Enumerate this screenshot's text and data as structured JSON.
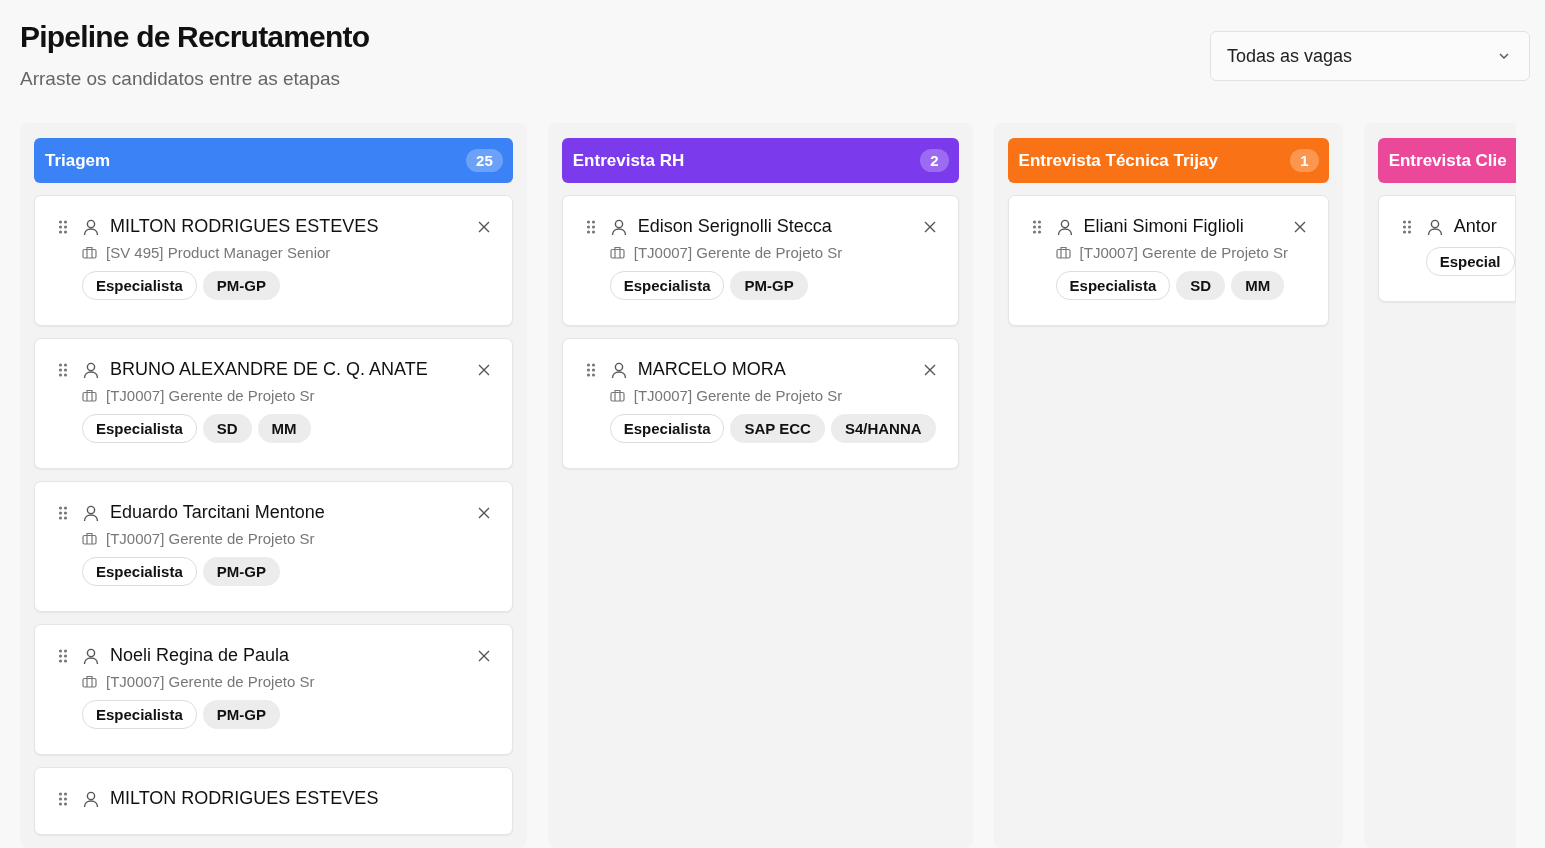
{
  "header": {
    "title": "Pipeline de Recrutamento",
    "subtitle": "Arraste os candidatos entre as etapas"
  },
  "filter": {
    "value": "Todas as vagas"
  },
  "columns": [
    {
      "title": "Triagem",
      "count": "25",
      "color": "#3b82f6",
      "cards": [
        {
          "name": "MILTON RODRIGUES ESTEVES",
          "job": "[SV 495] Product Manager Senior",
          "tags": [
            {
              "label": "Especialista",
              "kind": "level"
            },
            {
              "label": "PM-GP",
              "kind": "skill"
            }
          ]
        },
        {
          "name": "BRUNO ALEXANDRE DE C. Q. ANATE",
          "job": "[TJ0007] Gerente de Projeto Sr",
          "tags": [
            {
              "label": "Especialista",
              "kind": "level"
            },
            {
              "label": "SD",
              "kind": "skill"
            },
            {
              "label": "MM",
              "kind": "skill"
            }
          ]
        },
        {
          "name": "Eduardo Tarcitani Mentone",
          "job": "[TJ0007] Gerente de Projeto Sr",
          "tags": [
            {
              "label": "Especialista",
              "kind": "level"
            },
            {
              "label": "PM-GP",
              "kind": "skill"
            }
          ]
        },
        {
          "name": "Noeli Regina de Paula",
          "job": "[TJ0007] Gerente de Projeto Sr",
          "tags": [
            {
              "label": "Especialista",
              "kind": "level"
            },
            {
              "label": "PM-GP",
              "kind": "skill"
            }
          ]
        },
        {
          "name": "MILTON RODRIGUES ESTEVES"
        }
      ]
    },
    {
      "title": "Entrevista RH",
      "count": "2",
      "color": "#7c3aed",
      "cards": [
        {
          "name": "Edison Serignolli Stecca",
          "job": "[TJ0007] Gerente de Projeto Sr",
          "tags": [
            {
              "label": "Especialista",
              "kind": "level"
            },
            {
              "label": "PM-GP",
              "kind": "skill"
            }
          ]
        },
        {
          "name": "MARCELO MORA",
          "job": "[TJ0007] Gerente de Projeto Sr",
          "tags": [
            {
              "label": "Especialista",
              "kind": "level"
            },
            {
              "label": "SAP ECC",
              "kind": "skill"
            },
            {
              "label": "S4/HANNA",
              "kind": "skill"
            }
          ]
        }
      ]
    },
    {
      "title": "Entrevista Técnica Trijay",
      "count": "1",
      "color": "#f97316",
      "cards": [
        {
          "name": "Eliani Simoni Figlioli",
          "job": "[TJ0007] Gerente de Projeto Sr",
          "tags": [
            {
              "label": "Especialista",
              "kind": "level"
            },
            {
              "label": "SD",
              "kind": "skill"
            },
            {
              "label": "MM",
              "kind": "skill"
            }
          ]
        }
      ]
    },
    {
      "title": "Entrevista Clie",
      "color": "#ec4899",
      "cards": [
        {
          "name": "Antor",
          "tags": [
            {
              "label": "Especial",
              "kind": "level"
            }
          ]
        }
      ]
    }
  ]
}
